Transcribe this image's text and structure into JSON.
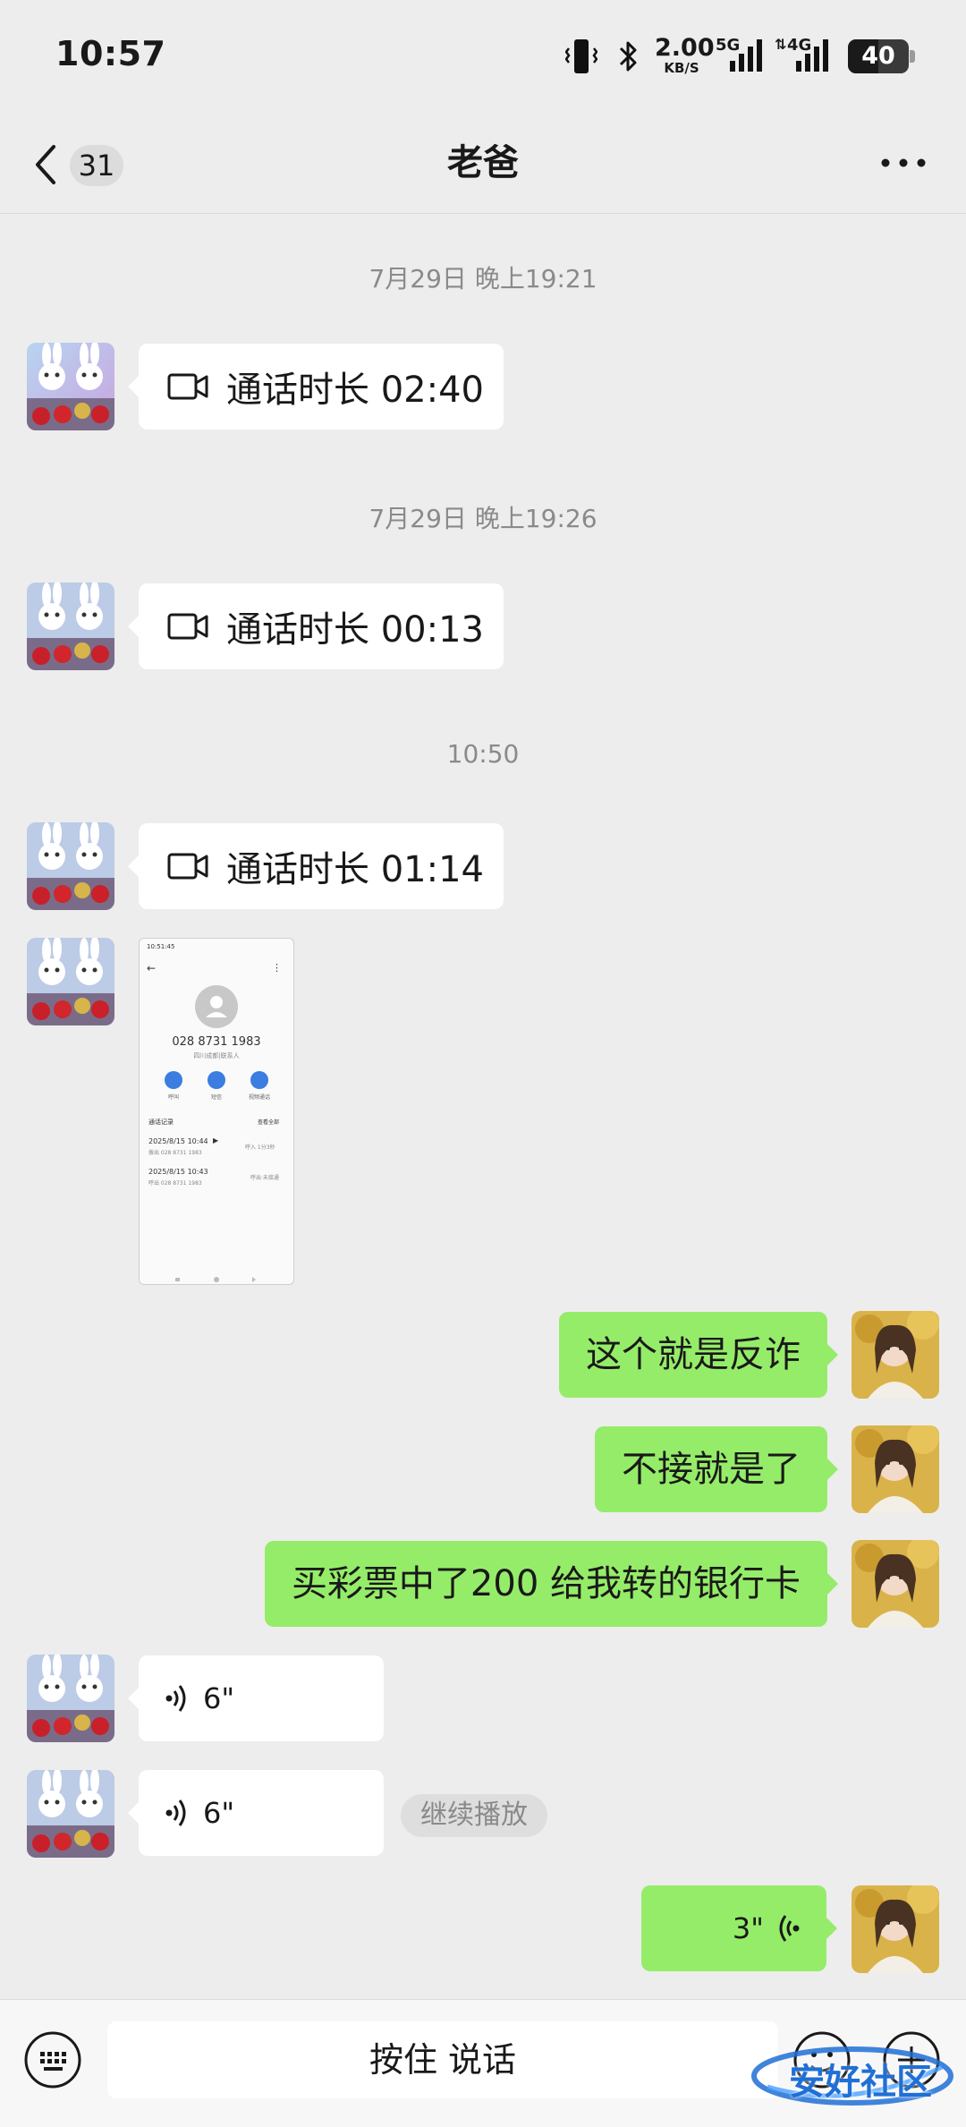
{
  "status_bar": {
    "time": "10:57",
    "net_speed_value": "2.00",
    "net_speed_unit": "KB/S",
    "signal_1_label": "5G",
    "signal_2_label": "4G",
    "battery": "40",
    "icons": [
      "vibrate-icon",
      "bluetooth-icon",
      "signal-5g-icon",
      "signal-4g-icon",
      "battery-icon"
    ]
  },
  "header": {
    "back_badge": "31",
    "title": "老爸",
    "icons": [
      "back-chevron-icon",
      "more-icon"
    ]
  },
  "messages": [
    {
      "type": "timestamp",
      "text": "7月29日 晚上19:21"
    },
    {
      "type": "video_call",
      "side": "left",
      "label": "通话时长 02:40"
    },
    {
      "type": "timestamp",
      "text": "7月29日 晚上19:26"
    },
    {
      "type": "video_call",
      "side": "left",
      "label": "通话时长 00:13"
    },
    {
      "type": "timestamp",
      "text": "10:50"
    },
    {
      "type": "video_call",
      "side": "left",
      "label": "通话时长 01:14"
    },
    {
      "type": "image",
      "side": "left"
    },
    {
      "type": "text",
      "side": "right",
      "text": "这个就是反诈"
    },
    {
      "type": "text",
      "side": "right",
      "text": "不接就是了"
    },
    {
      "type": "text",
      "side": "right",
      "text": "买彩票中了200 给我转的银行卡"
    },
    {
      "type": "voice",
      "side": "left",
      "duration": "6\""
    },
    {
      "type": "voice",
      "side": "left",
      "duration": "6\"",
      "action": "继续播放"
    },
    {
      "type": "voice",
      "side": "right",
      "duration": "3\""
    }
  ],
  "screenshot_thumb": {
    "status": "10:51:45",
    "phone_number": "028 8731 1983",
    "location": "四川成都|联系人",
    "actions": [
      "呼叫",
      "短信",
      "视频通话"
    ],
    "records_label": "通话记录",
    "see_all": "查看全部",
    "records": [
      {
        "time": "2025/8/15 10:44",
        "sub": "拨出 028 8731 1983",
        "note": "呼入 1分3秒"
      },
      {
        "time": "2025/8/15 10:43",
        "sub": "呼出 028 8731 1983",
        "note": "呼出·未接通"
      }
    ]
  },
  "input_bar": {
    "hold_to_talk": "按住 说话",
    "icons": [
      "keyboard-icon",
      "emoji-icon",
      "plus-icon"
    ]
  },
  "watermark": "安好社区",
  "colors": {
    "background": "#ededed",
    "bubble_sent": "#95ec69",
    "bubble_received": "#ffffff"
  }
}
